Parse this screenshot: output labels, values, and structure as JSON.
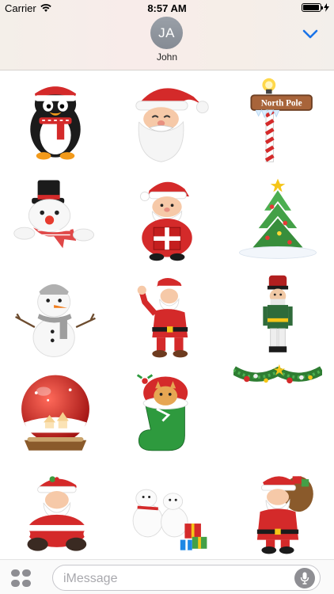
{
  "status_bar": {
    "carrier": "Carrier",
    "time": "8:57 AM",
    "battery_percent": 95
  },
  "header": {
    "avatar_initials": "JA",
    "contact_name": "John",
    "collapse_icon": "chevron-down-icon"
  },
  "stickers": [
    {
      "name": "penguin"
    },
    {
      "name": "santa-face"
    },
    {
      "name": "north-pole-sign",
      "label": "North Pole"
    },
    {
      "name": "snowman-face"
    },
    {
      "name": "santa-gift"
    },
    {
      "name": "christmas-tree"
    },
    {
      "name": "snowman"
    },
    {
      "name": "santa-thumbs-up"
    },
    {
      "name": "nutcracker"
    },
    {
      "name": "snow-globe"
    },
    {
      "name": "stocking-kitten"
    },
    {
      "name": "garland"
    },
    {
      "name": "santa-sitting"
    },
    {
      "name": "polar-bears"
    },
    {
      "name": "santa-sack"
    }
  ],
  "bottom_bar": {
    "apps_icon": "apps-icon",
    "input_placeholder": "iMessage",
    "mic_icon": "microphone-icon"
  },
  "colors": {
    "accent": "#1a73e8",
    "santa_red": "#d42a2a",
    "green": "#3d9a3d"
  }
}
